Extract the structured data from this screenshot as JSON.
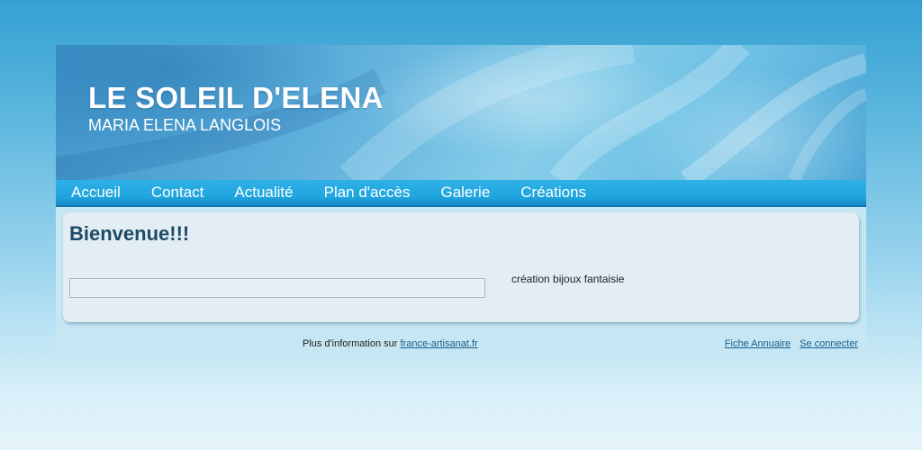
{
  "header": {
    "title": "LE SOLEIL D'ELENA",
    "subtitle": "MARIA ELENA LANGLOIS"
  },
  "nav": {
    "items": [
      {
        "label": "Accueil"
      },
      {
        "label": "Contact"
      },
      {
        "label": "Actualité"
      },
      {
        "label": "Plan d'accès"
      },
      {
        "label": "Galerie"
      },
      {
        "label": "Créations"
      }
    ]
  },
  "main": {
    "heading": "Bienvenue!!!",
    "description": "création bijoux fantaisie"
  },
  "footer": {
    "info_prefix": "Plus d'information sur ",
    "info_link": "france-artisanat.fr",
    "fiche_link": "Fiche Annuaire",
    "login_link": "Se connecter"
  },
  "colors": {
    "nav_bar": "#1ea4de",
    "heading": "#1d4a66",
    "link": "#1a5f8a",
    "content_bg": "#e3eef4"
  }
}
